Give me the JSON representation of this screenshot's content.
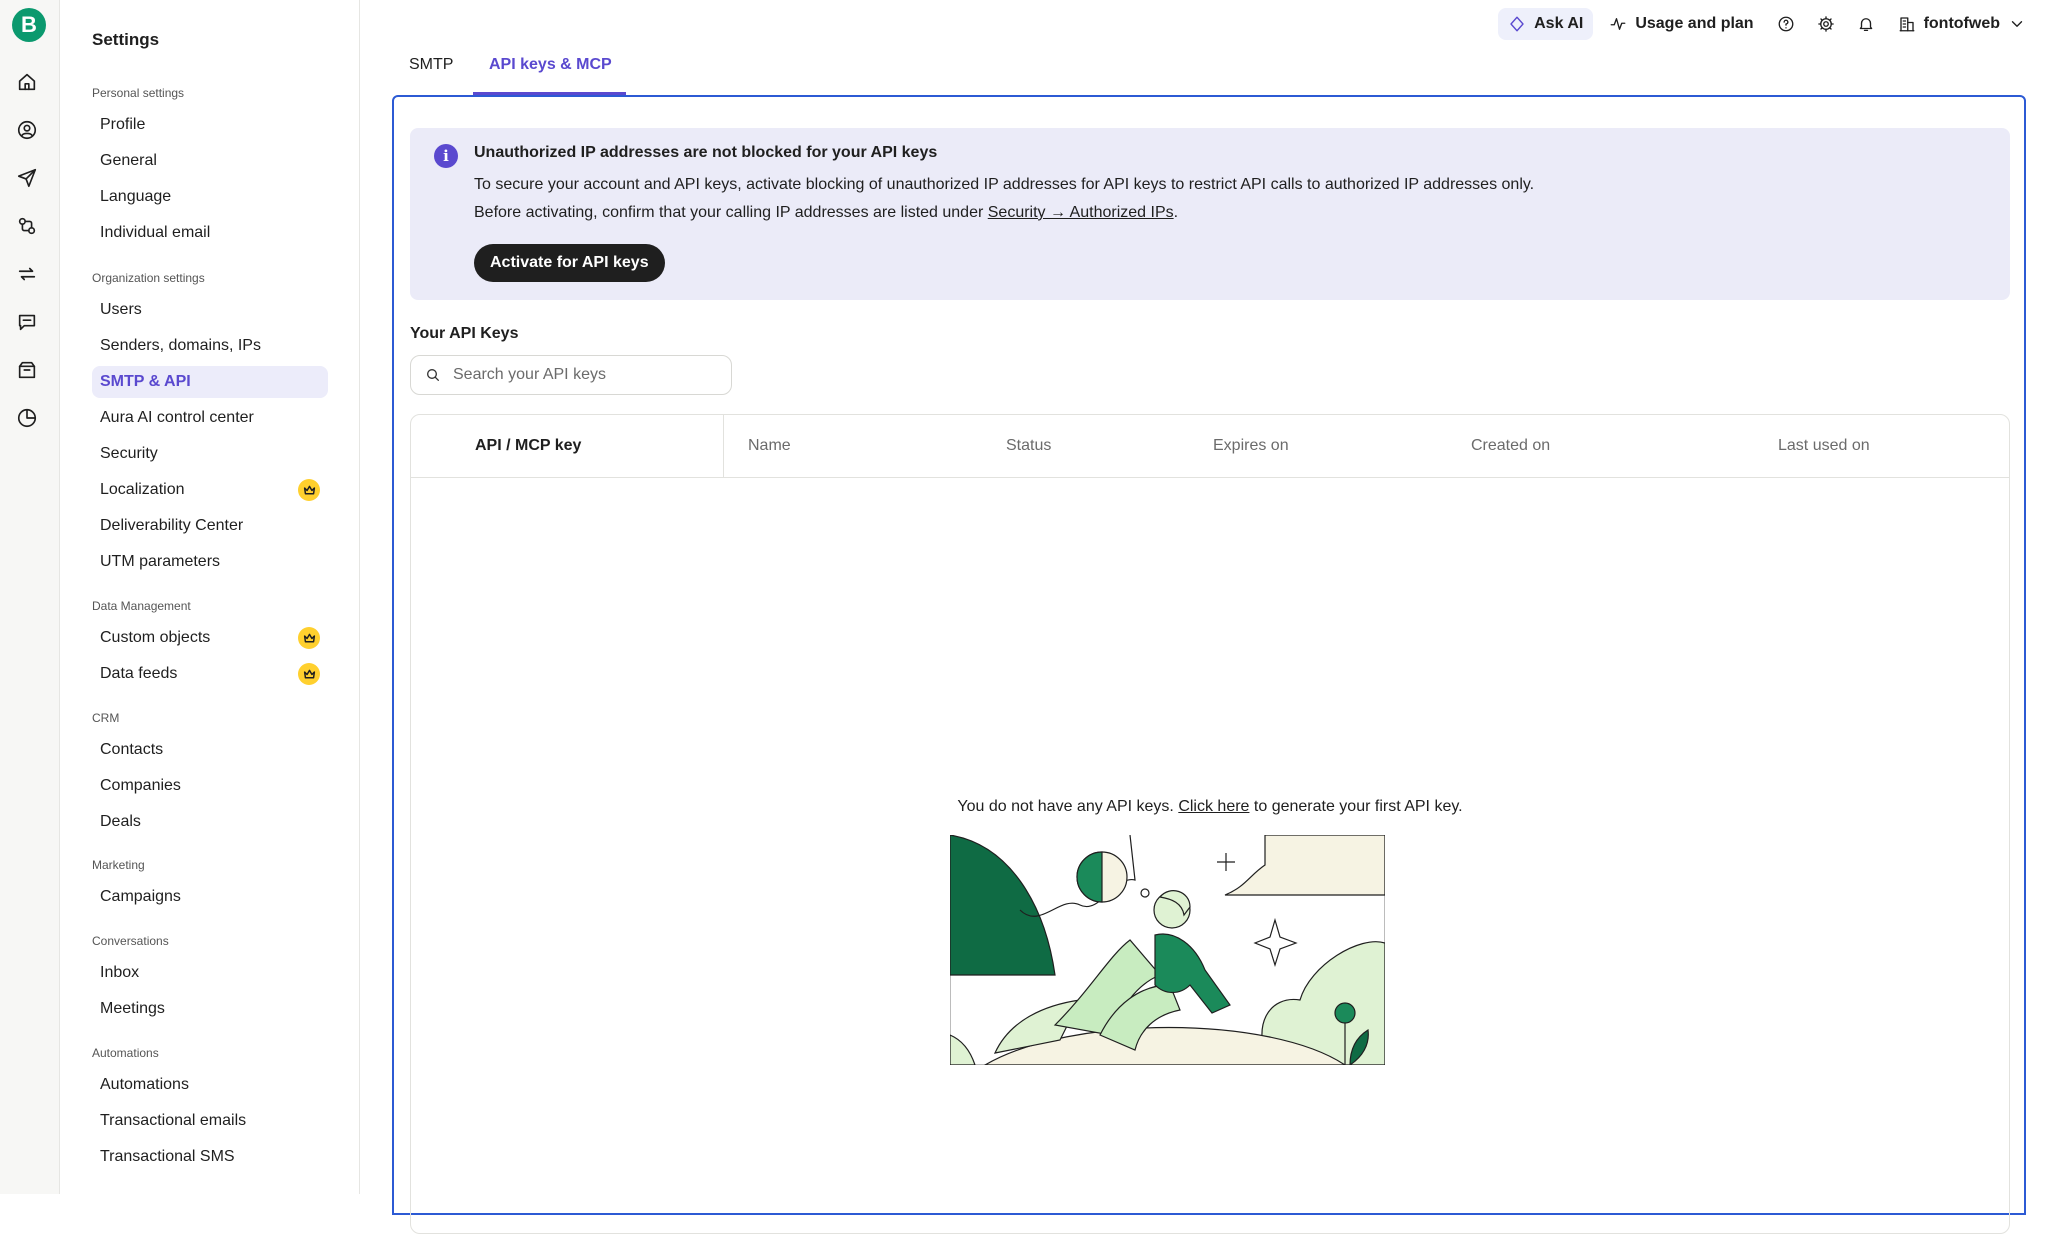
{
  "app": {
    "logo_letter": "B"
  },
  "rail": {
    "icons": [
      "home-icon",
      "contacts-icon",
      "send-icon",
      "automation-icon",
      "transfer-icon",
      "chat-icon",
      "inbox-icon",
      "reports-icon"
    ]
  },
  "sidebar": {
    "title": "Settings",
    "sections": [
      {
        "label": "Personal settings",
        "items": [
          "Profile",
          "General",
          "Language",
          "Individual email"
        ]
      },
      {
        "label": "Organization settings",
        "items": [
          "Users",
          "Senders, domains, IPs",
          "SMTP & API",
          "Aura AI control center",
          "Security",
          "Localization",
          "Deliverability Center",
          "UTM parameters"
        ]
      },
      {
        "label": "Data Management",
        "items": [
          "Custom objects",
          "Data feeds"
        ]
      },
      {
        "label": "CRM",
        "items": [
          "Contacts",
          "Companies",
          "Deals"
        ]
      },
      {
        "label": "Marketing",
        "items": [
          "Campaigns"
        ]
      },
      {
        "label": "Conversations",
        "items": [
          "Inbox",
          "Meetings"
        ]
      },
      {
        "label": "Automations",
        "items": [
          "Automations",
          "Transactional emails",
          "Transactional SMS"
        ]
      }
    ],
    "active_item": "SMTP & API"
  },
  "topbar": {
    "ask_ai": "Ask AI",
    "usage": "Usage and plan",
    "account": "fontofweb"
  },
  "tabs": [
    {
      "label": "SMTP",
      "active": false
    },
    {
      "label": "API keys & MCP",
      "active": true
    }
  ],
  "notice": {
    "title": "Unauthorized IP addresses are not blocked for your API keys",
    "line1": "To secure your account and API keys, activate blocking of unauthorized IP addresses for API keys to restrict API calls to authorized IP addresses only.",
    "line2_prefix": "Before activating, confirm that your calling IP addresses are listed under ",
    "line2_link": "Security → Authorized IPs",
    "line2_suffix": ".",
    "button": "Activate for API keys"
  },
  "keys": {
    "title": "Your API Keys",
    "search_placeholder": "Search your API keys",
    "columns": [
      "API / MCP key",
      "Name",
      "Status",
      "Expires on",
      "Created on",
      "Last used on"
    ],
    "empty_prefix": "You do not have any API keys. ",
    "empty_link": "Click here",
    "empty_suffix": " to generate your first API key."
  },
  "colors": {
    "accent": "#5a49cf",
    "brand_green": "#0b996e",
    "panel_border": "#2c5ad4",
    "notice_bg": "#ebebf8"
  }
}
